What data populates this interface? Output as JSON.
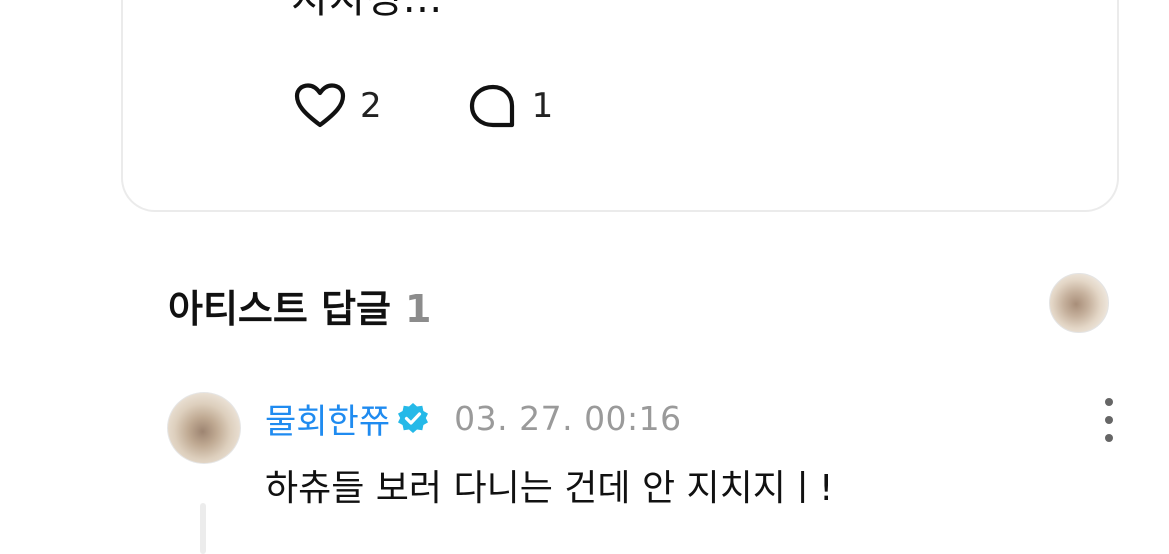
{
  "post": {
    "text": "지치징...",
    "likes": "2",
    "comments": "1"
  },
  "artist_replies": {
    "title": "아티스트 답글",
    "count": "1"
  },
  "comment": {
    "author": "물회한쮸",
    "timestamp": "03. 27. 00:16",
    "text": "하츄들 보러 다니는 건데 안 지치지ㅣ!"
  },
  "icons": {
    "like": "heart-outline-icon",
    "comment": "speech-bubble-icon",
    "verified": "verified-badge-icon",
    "more": "more-vertical-icon"
  },
  "colors": {
    "author": "#1f8bf0",
    "verified": "#25b9e8",
    "secondary_text": "#9a9a9a"
  }
}
